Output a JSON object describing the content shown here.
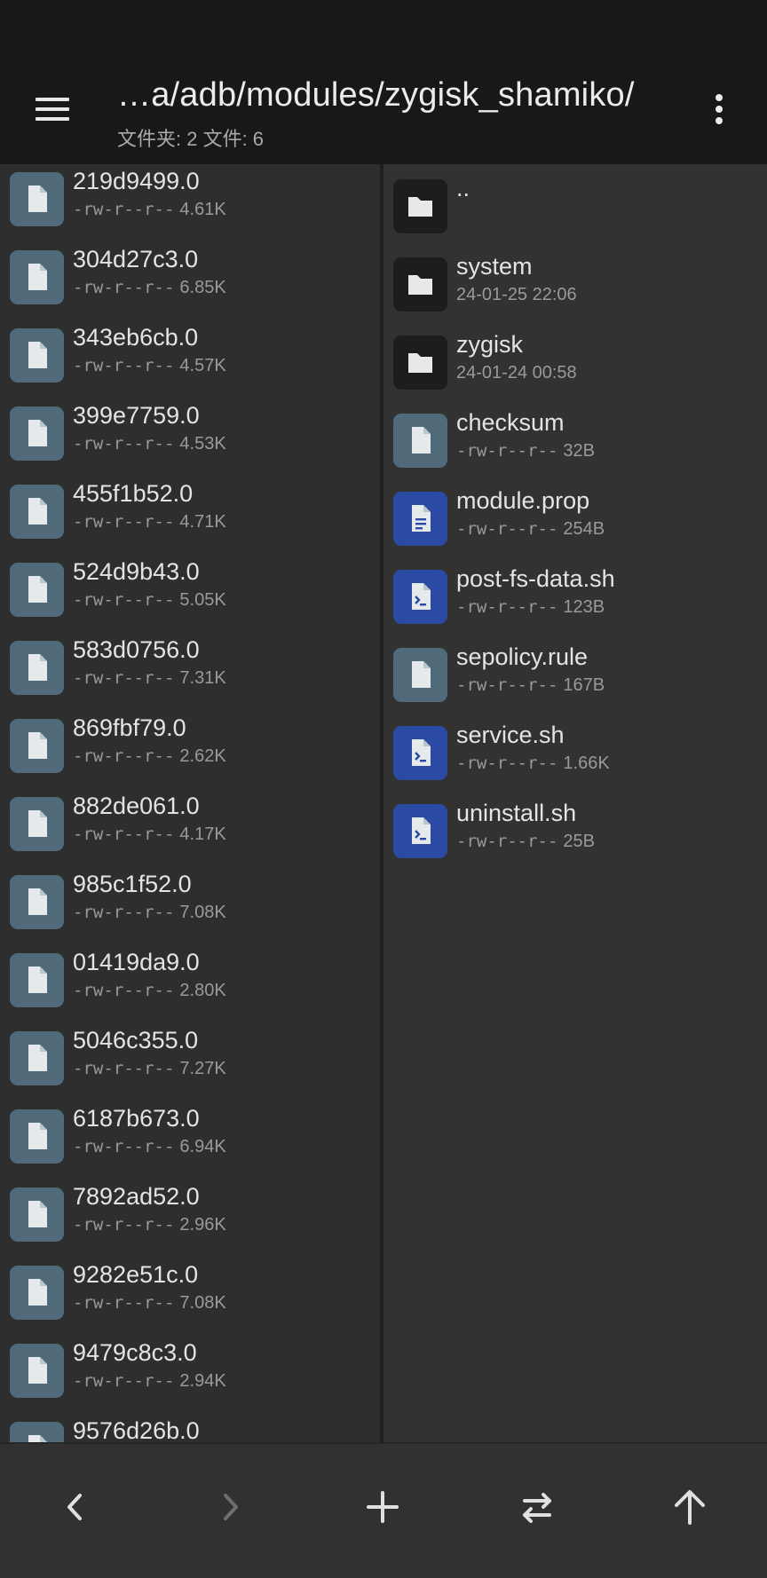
{
  "header": {
    "path": "…a/adb/modules/zygisk_shamiko/",
    "counts": "文件夹: 2  文件: 6"
  },
  "left_pane": {
    "items": [
      {
        "name": "219d9499.0",
        "perm": "-rw-r--r--",
        "size": "4.61K",
        "icon": "file-icon"
      },
      {
        "name": "304d27c3.0",
        "perm": "-rw-r--r--",
        "size": "6.85K",
        "icon": "file-icon"
      },
      {
        "name": "343eb6cb.0",
        "perm": "-rw-r--r--",
        "size": "4.57K",
        "icon": "file-icon"
      },
      {
        "name": "399e7759.0",
        "perm": "-rw-r--r--",
        "size": "4.53K",
        "icon": "file-icon"
      },
      {
        "name": "455f1b52.0",
        "perm": "-rw-r--r--",
        "size": "4.71K",
        "icon": "file-icon"
      },
      {
        "name": "524d9b43.0",
        "perm": "-rw-r--r--",
        "size": "5.05K",
        "icon": "file-icon"
      },
      {
        "name": "583d0756.0",
        "perm": "-rw-r--r--",
        "size": "7.31K",
        "icon": "file-icon"
      },
      {
        "name": "869fbf79.0",
        "perm": "-rw-r--r--",
        "size": "2.62K",
        "icon": "file-icon"
      },
      {
        "name": "882de061.0",
        "perm": "-rw-r--r--",
        "size": "4.17K",
        "icon": "file-icon"
      },
      {
        "name": "985c1f52.0",
        "perm": "-rw-r--r--",
        "size": "7.08K",
        "icon": "file-icon"
      },
      {
        "name": "01419da9.0",
        "perm": "-rw-r--r--",
        "size": "2.80K",
        "icon": "file-icon"
      },
      {
        "name": "5046c355.0",
        "perm": "-rw-r--r--",
        "size": "7.27K",
        "icon": "file-icon"
      },
      {
        "name": "6187b673.0",
        "perm": "-rw-r--r--",
        "size": "6.94K",
        "icon": "file-icon"
      },
      {
        "name": "7892ad52.0",
        "perm": "-rw-r--r--",
        "size": "2.96K",
        "icon": "file-icon"
      },
      {
        "name": "9282e51c.0",
        "perm": "-rw-r--r--",
        "size": "7.08K",
        "icon": "file-icon"
      },
      {
        "name": "9479c8c3.0",
        "perm": "-rw-r--r--",
        "size": "2.94K",
        "icon": "file-icon"
      },
      {
        "name": "9576d26b.0",
        "perm": "",
        "size": "",
        "icon": "file-icon"
      }
    ]
  },
  "right_pane": {
    "items": [
      {
        "name": "..",
        "perm": "",
        "size": "",
        "date": "",
        "icon": "folder-icon"
      },
      {
        "name": "system",
        "perm": "",
        "size": "",
        "date": "24-01-25 22:06",
        "icon": "folder-icon"
      },
      {
        "name": "zygisk",
        "perm": "",
        "size": "",
        "date": "24-01-24 00:58",
        "icon": "folder-icon"
      },
      {
        "name": "checksum",
        "perm": "-rw-r--r--",
        "size": "32B",
        "date": "",
        "icon": "file-icon"
      },
      {
        "name": "module.prop",
        "perm": "-rw-r--r--",
        "size": "254B",
        "date": "",
        "icon": "text-file-icon"
      },
      {
        "name": "post-fs-data.sh",
        "perm": "-rw-r--r--",
        "size": "123B",
        "date": "",
        "icon": "script-file-icon"
      },
      {
        "name": "sepolicy.rule",
        "perm": "-rw-r--r--",
        "size": "167B",
        "date": "",
        "icon": "file-icon"
      },
      {
        "name": "service.sh",
        "perm": "-rw-r--r--",
        "size": "1.66K",
        "date": "",
        "icon": "script-file-icon"
      },
      {
        "name": "uninstall.sh",
        "perm": "-rw-r--r--",
        "size": "25B",
        "date": "",
        "icon": "script-file-icon"
      }
    ]
  },
  "bottom_bar": {
    "buttons": [
      "back-icon",
      "forward-icon",
      "add-icon",
      "swap-panes-icon",
      "up-directory-icon"
    ]
  },
  "colors": {
    "background": "#181818",
    "pane": "#2e2e2e",
    "file_icon": "#516a7a",
    "script_icon": "#2b4aa4",
    "folder_icon": "#1d1d1d"
  }
}
